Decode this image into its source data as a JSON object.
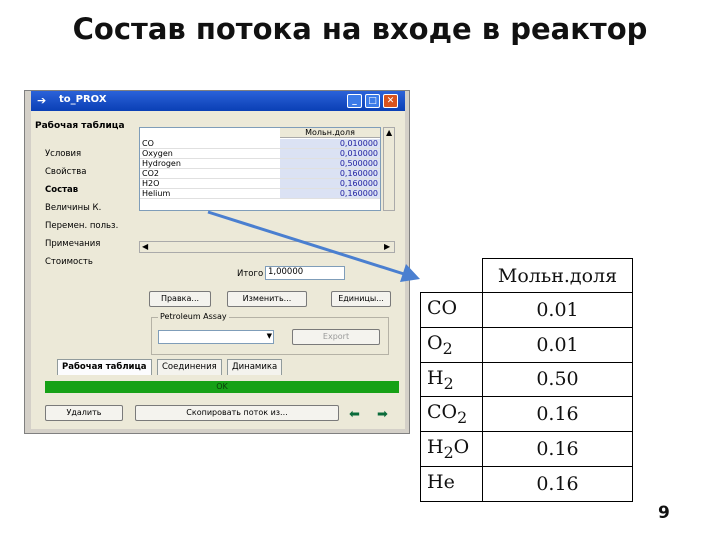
{
  "slide": {
    "title": "Состав потока на входе в реактор",
    "page_number": "9"
  },
  "dialog": {
    "title": "to_PROX",
    "title_buttons": [
      "minimize-icon",
      "maximize-icon",
      "close-icon"
    ],
    "nav": {
      "header": "Рабочая таблица",
      "items": [
        {
          "label": "Условия",
          "active": false
        },
        {
          "label": "Свойства",
          "active": false
        },
        {
          "label": "Состав",
          "active": true
        },
        {
          "label": "Величины К.",
          "active": false
        },
        {
          "label": "Перемен. польз.",
          "active": false
        },
        {
          "label": "Примечания",
          "active": false
        },
        {
          "label": "Стоимость",
          "active": false
        }
      ]
    },
    "grid": {
      "column_header": "Мольн.доля",
      "rows": [
        {
          "name": "CO",
          "value": "0,010000"
        },
        {
          "name": "Oxygen",
          "value": "0,010000"
        },
        {
          "name": "Hydrogen",
          "value": "0,500000"
        },
        {
          "name": "CO2",
          "value": "0,160000"
        },
        {
          "name": "H2O",
          "value": "0,160000"
        },
        {
          "name": "Helium",
          "value": "0,160000"
        }
      ]
    },
    "total_label": "Итого",
    "total_value": "1,00000",
    "buttons": {
      "edit": "Правка...",
      "change": "Изменить...",
      "units": "Единицы..."
    },
    "petroleum_assay": {
      "label": "Petroleum Assay",
      "selected": "",
      "export": "Export"
    },
    "tabs": [
      "Рабочая таблица",
      "Соединения",
      "Динамика"
    ],
    "active_tab": 0,
    "status": "OK",
    "delete_button": "Удалить",
    "copy_button": "Скопировать поток из..."
  },
  "composition_table": {
    "header": "Мольн.доля",
    "rows": [
      {
        "name": "CO",
        "sub": "",
        "value": "0.01"
      },
      {
        "name": "O",
        "sub": "2",
        "value": "0.01"
      },
      {
        "name": "H",
        "sub": "2",
        "value": "0.50"
      },
      {
        "name": "CO",
        "sub": "2",
        "value": "0.16"
      },
      {
        "name": "H",
        "sub": "2",
        "after": "O",
        "value": "0.16"
      },
      {
        "name": "He",
        "sub": "",
        "value": "0.16"
      }
    ]
  },
  "colors": {
    "titlebar": "#0a3fb5",
    "status_ok": "#16a116",
    "grid_value_bg": "#dbe2f4",
    "arrow": "#4a7fd0"
  }
}
